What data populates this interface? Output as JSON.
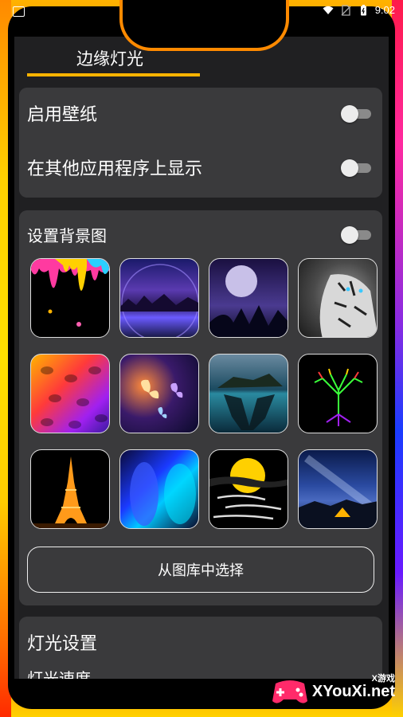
{
  "status": {
    "time": "9:02"
  },
  "tab": {
    "label": "边缘灯光"
  },
  "toggles": {
    "wallpaper_label": "启用壁纸",
    "wallpaper_on": false,
    "overlay_label": "在其他应用程序上显示",
    "overlay_on": false
  },
  "background": {
    "label": "设置背景图",
    "enabled": false,
    "thumbnails": [
      "paint-drips",
      "purple-night-lake",
      "moon-over-trees",
      "white-tiger",
      "colorful-leaves",
      "glowing-butterflies",
      "floating-island",
      "neon-tree",
      "eiffel-tower-night",
      "blue-abstract-waves",
      "sunset-clouds",
      "milky-way-tent"
    ],
    "pick_button": "从图库中选择"
  },
  "light_settings": {
    "title": "灯光设置",
    "speed_label": "灯光速度"
  },
  "watermark": {
    "text": "XYouXi.net",
    "small": "X游戏"
  },
  "colors": {
    "accent": "#ffb300",
    "card": "#3a3a3c",
    "screen": "#202022"
  }
}
